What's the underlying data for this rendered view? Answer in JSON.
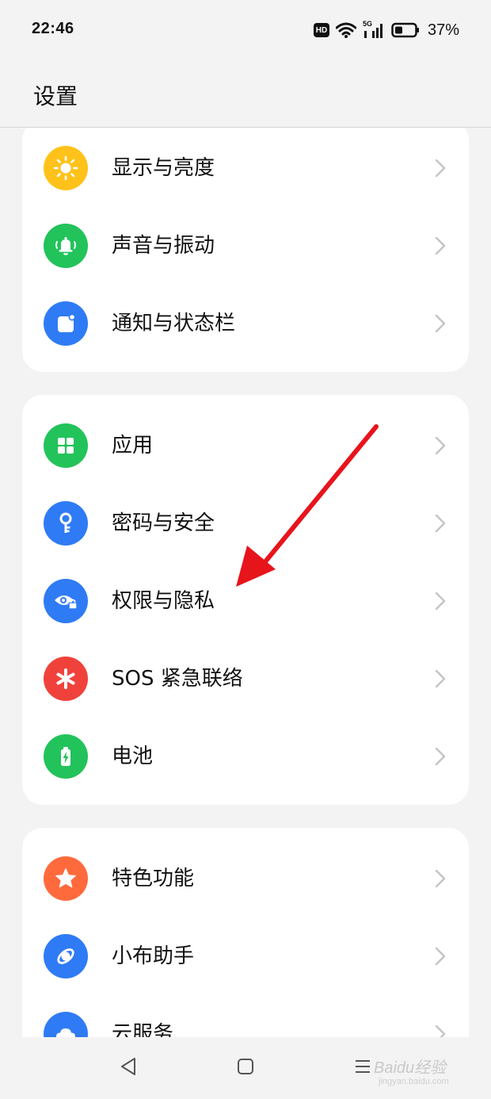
{
  "status": {
    "time": "22:46",
    "hd": "HD",
    "battery_text": "37%",
    "network": "5G"
  },
  "header": {
    "title": "设置"
  },
  "groups": [
    {
      "items": [
        {
          "label": "显示与亮度",
          "icon": "sun-icon",
          "color": "#FFC21A"
        },
        {
          "label": "声音与振动",
          "icon": "bell-icon",
          "color": "#22C35A"
        },
        {
          "label": "通知与状态栏",
          "icon": "notification-icon",
          "color": "#2F7BF5"
        }
      ]
    },
    {
      "items": [
        {
          "label": "应用",
          "icon": "apps-grid-icon",
          "color": "#22C35A"
        },
        {
          "label": "密码与安全",
          "icon": "key-icon",
          "color": "#2F7BF5"
        },
        {
          "label": "权限与隐私",
          "icon": "privacy-eye-icon",
          "color": "#2F7BF5"
        },
        {
          "label": "SOS 紧急联络",
          "icon": "asterisk-icon",
          "color": "#F0423B"
        },
        {
          "label": "电池",
          "icon": "battery-icon",
          "color": "#22C35A"
        }
      ]
    },
    {
      "items": [
        {
          "label": "特色功能",
          "icon": "star-icon",
          "color": "#FF6A3D"
        },
        {
          "label": "小布助手",
          "icon": "assistant-icon",
          "color": "#2F7BF5"
        },
        {
          "label": "云服务",
          "icon": "cloud-icon",
          "color": "#2F7BF5"
        }
      ]
    }
  ],
  "watermark": {
    "text": "Baidu经验",
    "sub": "jingyan.baidu.com"
  }
}
